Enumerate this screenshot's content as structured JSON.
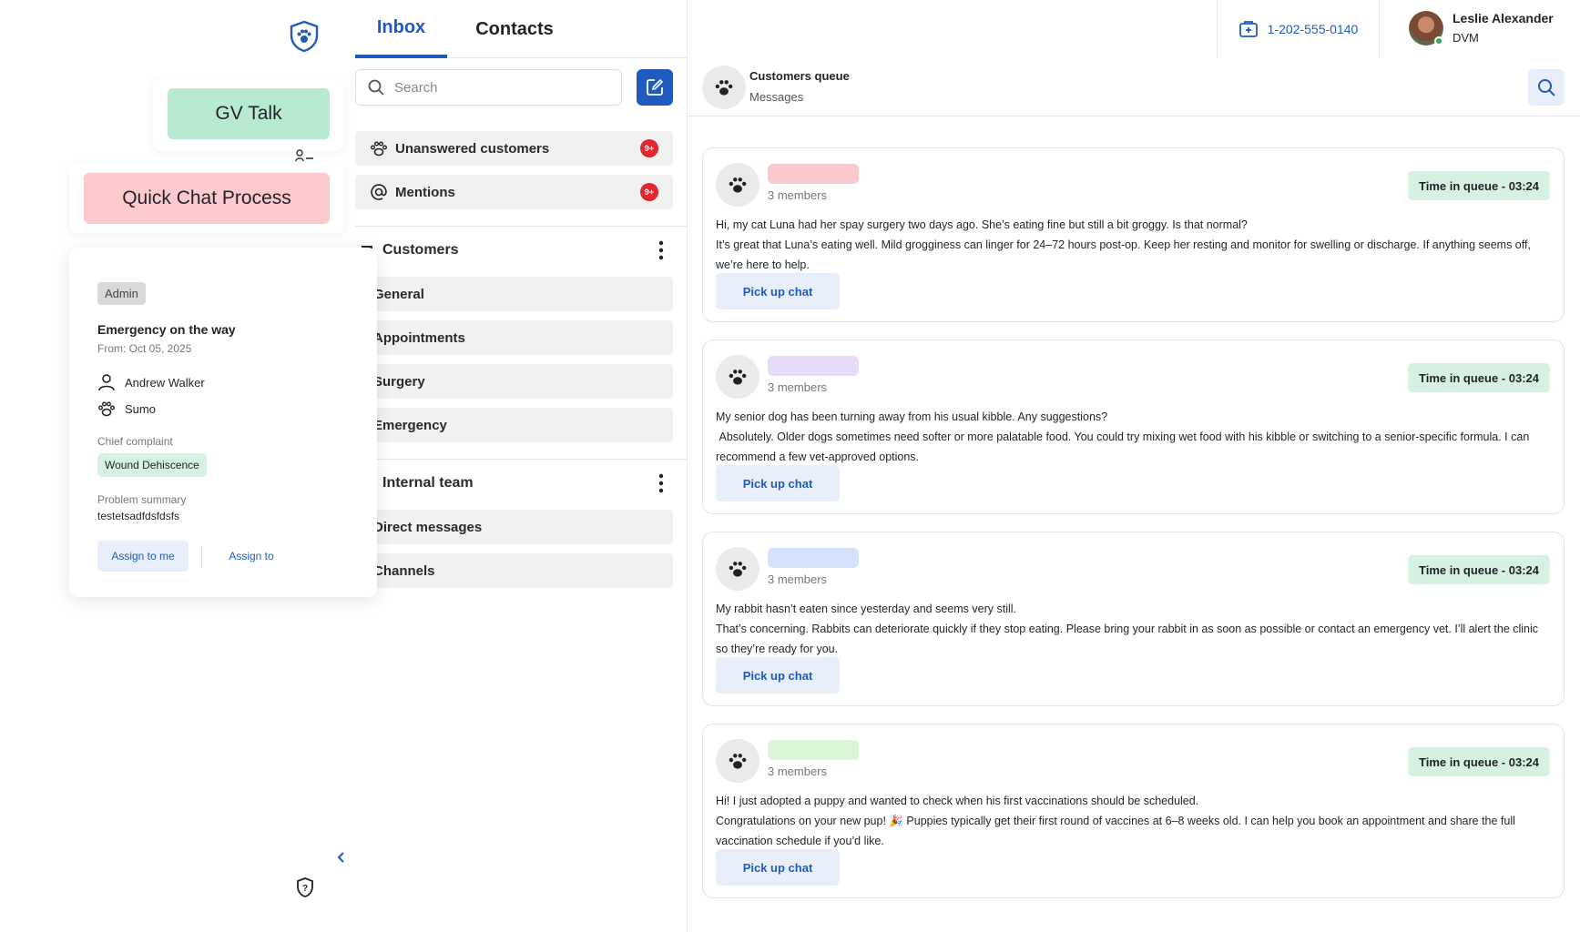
{
  "rail": {
    "gv_talk_label": "GV Talk",
    "quick_chat_label": "Quick Chat Process"
  },
  "popup": {
    "role": "Admin",
    "title": "Emergency on the way",
    "from": "From: Oct 05, 2025",
    "owner": "Andrew Walker",
    "pet": "Sumo",
    "chief_complaint_label": "Chief complaint",
    "chief_complaint": "Wound Dehiscence",
    "problem_summary_label": "Problem summary",
    "problem_summary": "testetsadfdsfdsfs",
    "assign_me_label": "Assign to me",
    "assign_to_label": "Assign to"
  },
  "tabs": {
    "inbox": "Inbox",
    "contacts": "Contacts"
  },
  "search": {
    "placeholder": "Search"
  },
  "queues": [
    {
      "label": "Unanswered customers",
      "badge": "9+"
    },
    {
      "label": "Mentions",
      "badge": "9+"
    }
  ],
  "customers": {
    "title": "Customers",
    "items": [
      "General",
      "Appointments",
      "Surgery",
      "Emergency"
    ]
  },
  "internal": {
    "title": "Internal team",
    "items": [
      "Direct messages",
      "Channels"
    ]
  },
  "topbar": {
    "phone": "1-202-555-0140",
    "user_name": "Leslie Alexander",
    "user_title": "DVM"
  },
  "chat": {
    "header_title": "Customers queue",
    "header_subtitle": "Messages",
    "pick_label": "Pick up chat",
    "cards": [
      {
        "members": "3 members",
        "timer": "Time in queue - 03:24",
        "pill_color": "#fbc8ce",
        "question": "Hi, my cat Luna had her spay surgery two days ago. She’s eating fine but still a bit groggy. Is that normal?",
        "answer": "It’s great that Luna’s eating well. Mild grogginess can linger for 24–72 hours post-op. Keep her resting and monitor for swelling or discharge. If anything seems off, we’re here to help."
      },
      {
        "members": "3 members",
        "timer": "Time in queue - 03:24",
        "pill_color": "#e6dcf7",
        "question": "My senior dog has been turning away from his usual kibble. Any suggestions?",
        "answer": " Absolutely. Older dogs sometimes need softer or more palatable food. You could try mixing wet food with his kibble or switching to a senior-specific formula. I can recommend a few vet-approved options."
      },
      {
        "members": "3 members",
        "timer": "Time in queue - 03:24",
        "pill_color": "#d4e2fb",
        "question": "My rabbit hasn’t eaten since yesterday and seems very still.",
        "answer": "That’s concerning. Rabbits can deteriorate quickly if they stop eating. Please bring your rabbit in as soon as possible or contact an emergency vet. I’ll alert the clinic so they’re ready for you."
      },
      {
        "members": "3 members",
        "timer": "Time in queue - 03:24",
        "pill_color": "#dcf5d9",
        "question": "Hi! I just adopted a puppy and wanted to check when his first vaccinations should be scheduled.",
        "answer": "Congratulations on your new pup! 🎉 Puppies typically get their first round of vaccines at 6–8 weeks old. I can help you book an appointment and share the full vaccination schedule if you’d like."
      }
    ]
  }
}
